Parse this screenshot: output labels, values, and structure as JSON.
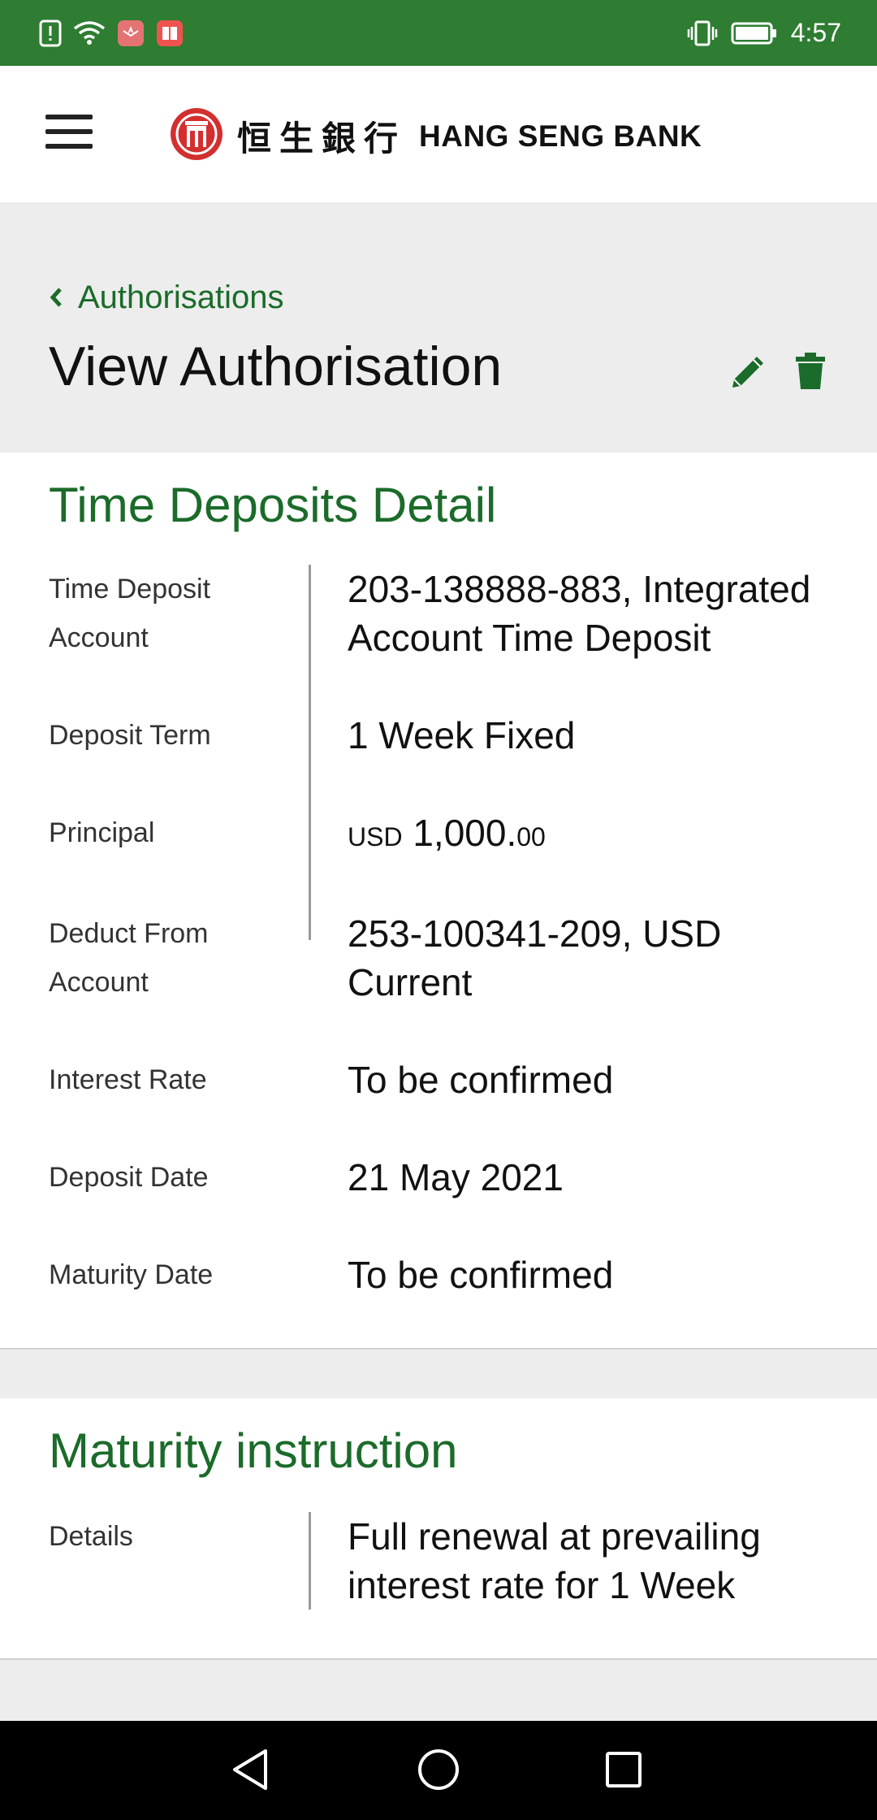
{
  "status_bar": {
    "time": "4:57",
    "icons": [
      "alert-sim-icon",
      "wifi-icon",
      "huawei-app-icon",
      "news-app-icon",
      "vibrate-icon",
      "battery-icon"
    ]
  },
  "header": {
    "logo_cn": "恒生銀行",
    "logo_en": "HANG SENG BANK"
  },
  "page": {
    "breadcrumb": "Authorisations",
    "title": "View Authorisation"
  },
  "time_deposits": {
    "title": "Time Deposits Detail",
    "rows": [
      {
        "label": "Time Deposit Account",
        "value": "203-138888-883, Integrated Account Time Deposit"
      },
      {
        "label": "Deposit Term",
        "value": "1 Week Fixed"
      },
      {
        "label": "Principal",
        "currency": "USD",
        "amount": "1,000.",
        "decimals": "00"
      },
      {
        "label": "Deduct From Account",
        "value": "253-100341-209, USD Current"
      },
      {
        "label": "Interest Rate",
        "value": "To be confirmed"
      },
      {
        "label": "Deposit Date",
        "value": "21 May 2021"
      },
      {
        "label": "Maturity Date",
        "value": "To be confirmed"
      }
    ]
  },
  "maturity": {
    "title": "Maturity instruction",
    "rows": [
      {
        "label": "Details",
        "value": "Full renewal at prevailing interest rate for 1 Week"
      }
    ]
  },
  "colors": {
    "brand_green": "#2e7d32",
    "accent_green": "#1b6b2a",
    "logo_red": "#d32f2f"
  }
}
